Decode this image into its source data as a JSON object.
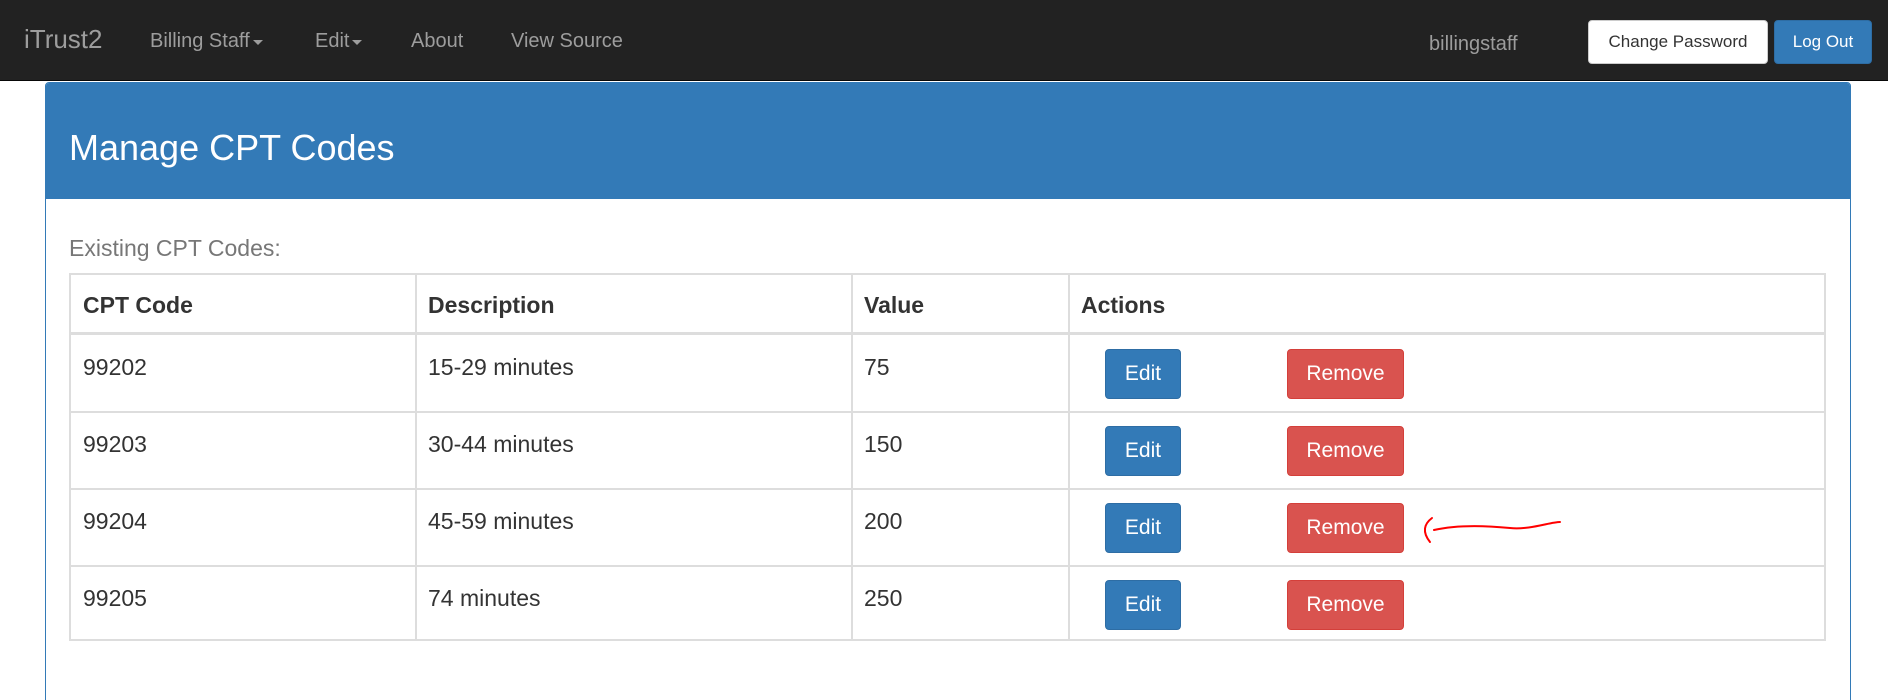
{
  "navbar": {
    "brand": "iTrust2",
    "menu": [
      {
        "label": "Billing Staff",
        "dropdown": true
      },
      {
        "label": "Edit",
        "dropdown": true
      },
      {
        "label": "About",
        "dropdown": false
      },
      {
        "label": "View Source",
        "dropdown": false
      }
    ],
    "username": "billingstaff",
    "change_password_label": "Change Password",
    "logout_label": "Log Out"
  },
  "panel": {
    "title": "Manage CPT Codes",
    "caption": "Existing CPT Codes:"
  },
  "table": {
    "headers": [
      "CPT Code",
      "Description",
      "Value",
      "Actions"
    ],
    "rows": [
      {
        "code": "99202",
        "description": "15-29 minutes",
        "value": "75"
      },
      {
        "code": "99203",
        "description": "30-44 minutes",
        "value": "150"
      },
      {
        "code": "99204",
        "description": "45-59 minutes",
        "value": "200"
      },
      {
        "code": "99205",
        "description": "74 minutes",
        "value": "250"
      }
    ],
    "edit_label": "Edit",
    "remove_label": "Remove"
  },
  "colors": {
    "navbar": "#222222",
    "primary": "#337ab7",
    "danger": "#d9534f",
    "annotation": "#ff0000"
  }
}
